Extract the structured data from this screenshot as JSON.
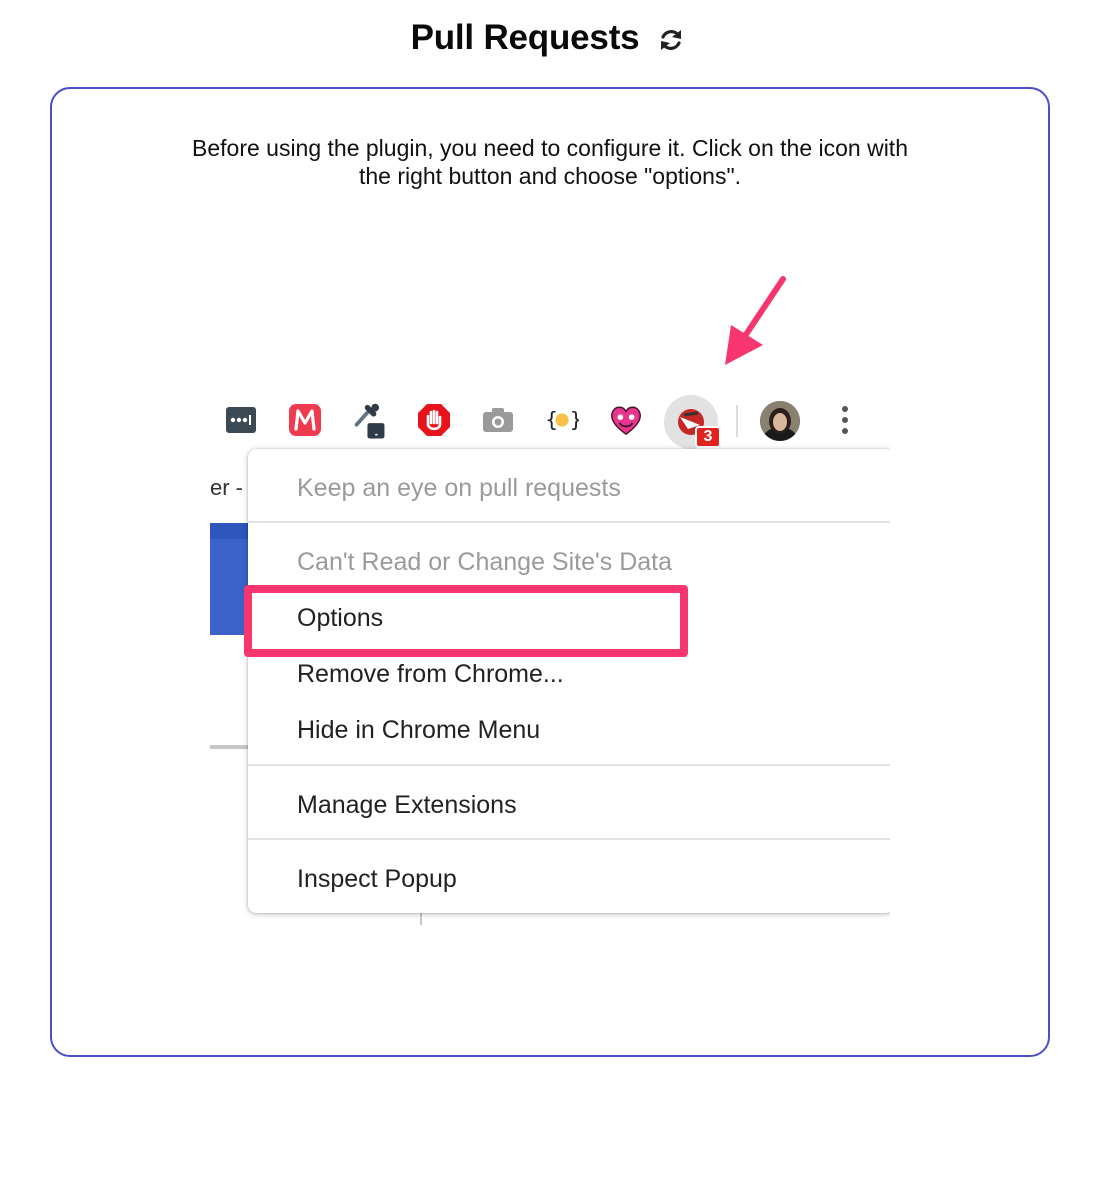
{
  "header": {
    "title": "Pull Requests",
    "refresh_icon": "refresh-icon"
  },
  "instructions": {
    "text": "Before using the plugin, you need to configure it. Click on the icon with the right button and choose \"options\"."
  },
  "screenshot": {
    "toolbar_icons": [
      "password-manager-icon",
      "m-extension-icon",
      "color-picker-icon",
      "adblock-icon",
      "camera-icon",
      "json-formatter-icon",
      "heart-face-icon",
      "pull-requests-extension-icon",
      "user-avatar",
      "more-vert-icon"
    ],
    "badge_count": "3",
    "background_text": "er -",
    "menu": {
      "items": [
        {
          "label": "Keep an eye on pull requests",
          "disabled": true
        },
        {
          "label": "Can't Read or Change Site's Data",
          "disabled": true
        },
        {
          "label": "Options",
          "disabled": false
        },
        {
          "label": "Remove from Chrome...",
          "disabled": false
        },
        {
          "label": "Hide in Chrome Menu",
          "disabled": false
        },
        {
          "label": "Manage Extensions",
          "disabled": false
        },
        {
          "label": "Inspect Popup",
          "disabled": false
        }
      ]
    }
  },
  "colors": {
    "card_border": "#4a4fc9",
    "highlight": "#f7356e",
    "arrow": "#f7356e",
    "badge": "#e0231f"
  }
}
